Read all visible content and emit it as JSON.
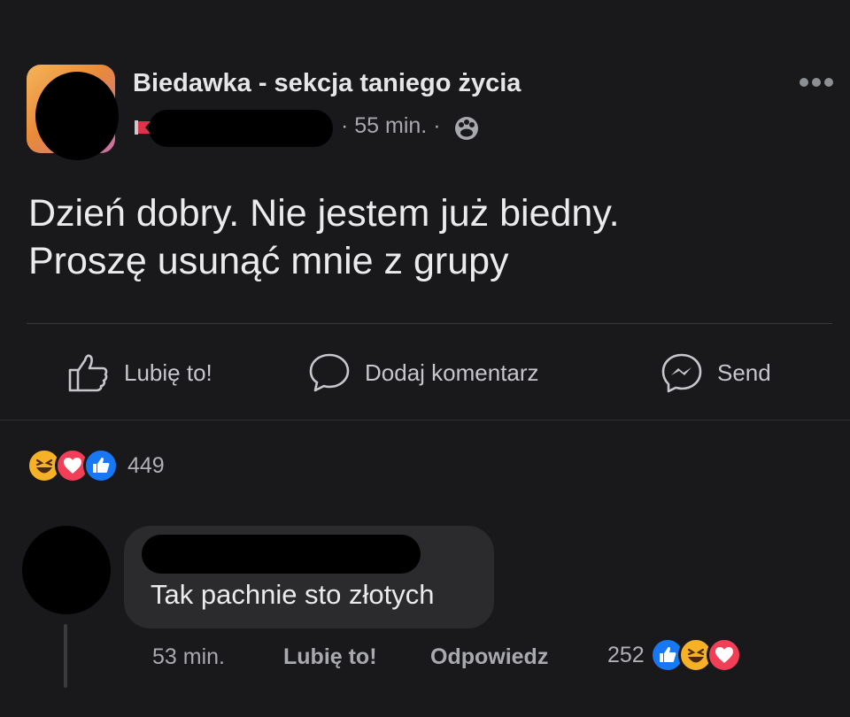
{
  "post": {
    "group_name": "Biedawka - sekcja taniego życia",
    "time": "· 55 min. ·",
    "text_line1": "Dzień dobry. Nie jestem już biedny.",
    "text_line2": "Proszę usunąć mnie z grupy"
  },
  "actions": {
    "like": "Lubię to!",
    "comment": "Dodaj komentarz",
    "send": "Send"
  },
  "reactions": {
    "count": "449",
    "icons": [
      "haha-reaction",
      "love-reaction",
      "like-reaction"
    ]
  },
  "comment": {
    "text": "Tak pachnie sto złotych",
    "time": "53 min.",
    "like": "Lubię to!",
    "reply": "Odpowiedz",
    "reaction_count": "252",
    "reaction_icons": [
      "like-reaction",
      "haha-reaction",
      "love-reaction"
    ]
  },
  "colors": {
    "background": "#19181a",
    "bubble": "#2b2b2d",
    "like_blue": "#1877f2",
    "love_red": "#f33e58",
    "haha_yellow": "#f7b125"
  }
}
